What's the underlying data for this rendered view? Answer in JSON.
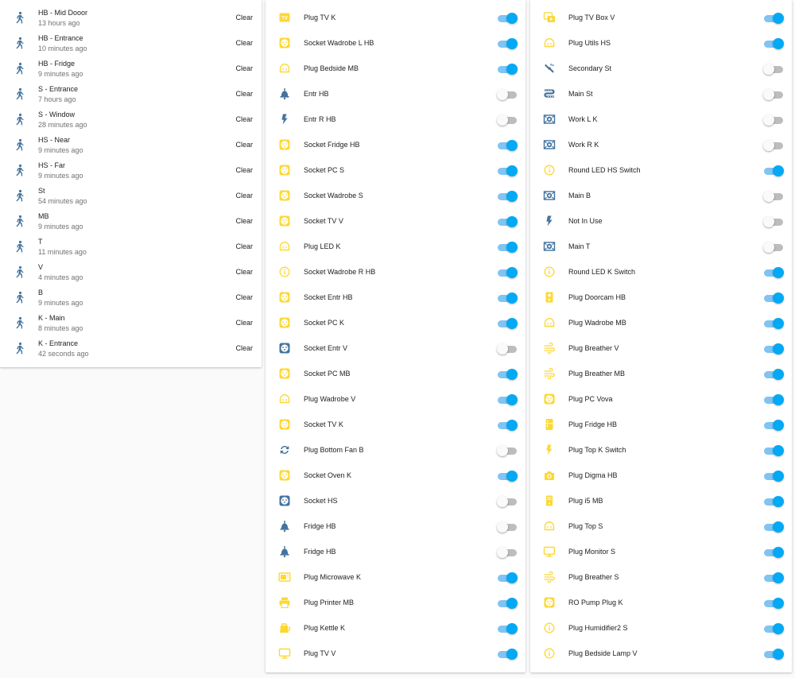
{
  "colors": {
    "icon_off": "#44739e",
    "icon_on": "#fdd835",
    "toggle_on": "#03a9f4",
    "toggle_off": "#bdbdbd"
  },
  "motion_sensors": [
    {
      "name": "HB - Mid Dooor",
      "time": "13 hours ago",
      "state": "Clear",
      "icon": "walk-icon"
    },
    {
      "name": "HB - Entrance",
      "time": "10 minutes ago",
      "state": "Clear",
      "icon": "walk-icon"
    },
    {
      "name": "HB - Fridge",
      "time": "9 minutes ago",
      "state": "Clear",
      "icon": "walk-icon"
    },
    {
      "name": "S - Entrance",
      "time": "7 hours ago",
      "state": "Clear",
      "icon": "walk-icon"
    },
    {
      "name": "S - Window",
      "time": "28 minutes ago",
      "state": "Clear",
      "icon": "walk-icon"
    },
    {
      "name": "HS - Near",
      "time": "9 minutes ago",
      "state": "Clear",
      "icon": "walk-icon"
    },
    {
      "name": "HS - Far",
      "time": "9 minutes ago",
      "state": "Clear",
      "icon": "walk-icon"
    },
    {
      "name": "St",
      "time": "54 minutes ago",
      "state": "Clear",
      "icon": "walk-icon"
    },
    {
      "name": "MB",
      "time": "9 minutes ago",
      "state": "Clear",
      "icon": "walk-icon"
    },
    {
      "name": "T",
      "time": "11 minutes ago",
      "state": "Clear",
      "icon": "walk-icon"
    },
    {
      "name": "V",
      "time": "4 minutes ago",
      "state": "Clear",
      "icon": "walk-icon"
    },
    {
      "name": "B",
      "time": "9 minutes ago",
      "state": "Clear",
      "icon": "walk-icon"
    },
    {
      "name": "K - Main",
      "time": "8 minutes ago",
      "state": "Clear",
      "icon": "walk-icon"
    },
    {
      "name": "K - Entrance",
      "time": "42 seconds ago",
      "state": "Clear",
      "icon": "walk-icon"
    }
  ],
  "switches_a": [
    {
      "name": "Plug TV K",
      "on": true,
      "icon": "tv-box-icon"
    },
    {
      "name": "Socket Wadrobe L HB",
      "on": true,
      "icon": "socket-icon"
    },
    {
      "name": "Plug Bedside MB",
      "on": true,
      "icon": "power-socket-icon"
    },
    {
      "name": "Entr HB",
      "on": false,
      "icon": "ceiling-light-icon"
    },
    {
      "name": "Entr R HB",
      "on": false,
      "icon": "flash-icon"
    },
    {
      "name": "Socket Fridge HB",
      "on": true,
      "icon": "socket-icon"
    },
    {
      "name": "Socket PC S",
      "on": true,
      "icon": "socket-icon"
    },
    {
      "name": "Socket Wadrobe S",
      "on": true,
      "icon": "socket-icon"
    },
    {
      "name": "Socket TV V",
      "on": true,
      "icon": "socket-icon"
    },
    {
      "name": "Plug LED K",
      "on": true,
      "icon": "power-socket-icon"
    },
    {
      "name": "Socket Wadrobe R HB",
      "on": true,
      "icon": "info-circle-icon"
    },
    {
      "name": "Socket Entr HB",
      "on": true,
      "icon": "socket-icon"
    },
    {
      "name": "Socket PC K",
      "on": true,
      "icon": "socket-icon"
    },
    {
      "name": "Socket Entr V",
      "on": false,
      "icon": "socket-icon"
    },
    {
      "name": "Socket PC MB",
      "on": true,
      "icon": "socket-icon"
    },
    {
      "name": "Plug Wadrobe V",
      "on": true,
      "icon": "power-socket-icon"
    },
    {
      "name": "Socket TV K",
      "on": true,
      "icon": "socket-icon"
    },
    {
      "name": "Plug Bottom Fan B",
      "on": false,
      "icon": "sync-icon"
    },
    {
      "name": "Socket Oven K",
      "on": true,
      "icon": "socket-icon"
    },
    {
      "name": "Socket HS",
      "on": false,
      "icon": "socket-icon"
    },
    {
      "name": "Fridge HB",
      "on": false,
      "icon": "ceiling-light-icon"
    },
    {
      "name": "Fridge HB",
      "on": false,
      "icon": "ceiling-light-icon"
    },
    {
      "name": "Plug Microwave K",
      "on": true,
      "icon": "microwave-icon"
    },
    {
      "name": "Plug Printer MB",
      "on": true,
      "icon": "printer-icon"
    },
    {
      "name": "Plug Kettle K",
      "on": true,
      "icon": "kettle-icon"
    },
    {
      "name": "Plug TV V",
      "on": true,
      "icon": "monitor-icon"
    }
  ],
  "switches_b": [
    {
      "name": "Plug TV Box V",
      "on": true,
      "icon": "tv-box-play-icon"
    },
    {
      "name": "Plug Utils HS",
      "on": true,
      "icon": "power-socket-icon"
    },
    {
      "name": "Secondary St",
      "on": false,
      "icon": "spotlight-icon"
    },
    {
      "name": "Main St",
      "on": false,
      "icon": "led-strip-icon"
    },
    {
      "name": "Work L K",
      "on": false,
      "icon": "light-panel-icon"
    },
    {
      "name": "Work R K",
      "on": false,
      "icon": "light-panel-icon"
    },
    {
      "name": "Round LED HS Switch",
      "on": true,
      "icon": "info-circle-icon"
    },
    {
      "name": "Main B",
      "on": false,
      "icon": "light-panel-icon"
    },
    {
      "name": "Not In Use",
      "on": false,
      "icon": "flash-icon"
    },
    {
      "name": "Main T",
      "on": false,
      "icon": "light-panel-icon"
    },
    {
      "name": "Round LED K Switch",
      "on": true,
      "icon": "info-circle-icon"
    },
    {
      "name": "Plug Doorcam HB",
      "on": true,
      "icon": "doorbell-icon"
    },
    {
      "name": "Plug Wadrobe MB",
      "on": true,
      "icon": "power-socket-icon"
    },
    {
      "name": "Plug Breather V",
      "on": true,
      "icon": "air-flow-icon"
    },
    {
      "name": "Plug Breather MB",
      "on": true,
      "icon": "air-flow-icon"
    },
    {
      "name": "Plug PC Vova",
      "on": true,
      "icon": "socket-icon"
    },
    {
      "name": "Plug Fridge HB",
      "on": true,
      "icon": "fridge-icon"
    },
    {
      "name": "Plug Top K Switch",
      "on": true,
      "icon": "flash-icon"
    },
    {
      "name": "Plug Digma HB",
      "on": true,
      "icon": "camera-icon"
    },
    {
      "name": "Plug i5 MB",
      "on": true,
      "icon": "desktop-tower-icon"
    },
    {
      "name": "Plug Top S",
      "on": true,
      "icon": "power-socket-icon"
    },
    {
      "name": "Plug Monitor S",
      "on": true,
      "icon": "monitor-icon"
    },
    {
      "name": "Plug Breather S",
      "on": true,
      "icon": "air-flow-icon"
    },
    {
      "name": "RO Pump Plug K",
      "on": true,
      "icon": "socket-icon"
    },
    {
      "name": "Plug Humidifier2 S",
      "on": true,
      "icon": "info-circle-icon"
    },
    {
      "name": "Plug Bedside Lamp V",
      "on": true,
      "icon": "info-circle-icon"
    }
  ]
}
